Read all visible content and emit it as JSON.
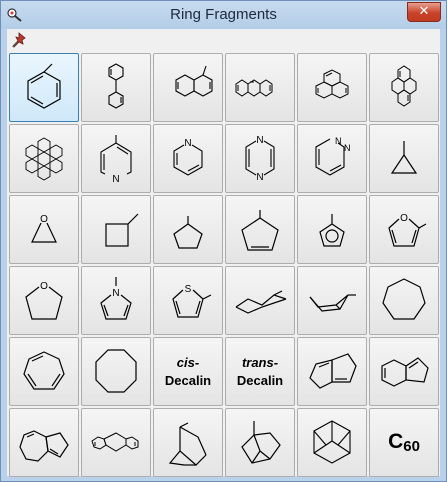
{
  "window": {
    "title": "Ring Fragments",
    "close_label": "✕"
  },
  "toolbar": {
    "pin_icon": "pin-icon"
  },
  "fragments": [
    {
      "id": "methylbenzene",
      "icon": "benzene-icon"
    },
    {
      "id": "biphenyl",
      "icon": "biphenyl-icon"
    },
    {
      "id": "methylnaphthalene",
      "icon": "naphthalene-icon"
    },
    {
      "id": "anthracene",
      "icon": "anthracene-icon"
    },
    {
      "id": "phenanthrene",
      "icon": "phenanthrene-icon"
    },
    {
      "id": "pyrene",
      "icon": "pyrene-icon"
    },
    {
      "id": "coronene",
      "icon": "coronene-icon"
    },
    {
      "id": "pyridine",
      "icon": "pyridine-icon",
      "atom": "N"
    },
    {
      "id": "pyrimidine",
      "icon": "pyrimidine-icon",
      "atom": "N"
    },
    {
      "id": "pyrazine",
      "icon": "pyrazine-icon",
      "atom": "N"
    },
    {
      "id": "pyridazine",
      "icon": "pyridazine-icon",
      "atom": "N"
    },
    {
      "id": "cyclopropane",
      "icon": "cyclopropane-icon"
    },
    {
      "id": "oxirane",
      "icon": "oxirane-icon",
      "atom": "O"
    },
    {
      "id": "cyclobutane",
      "icon": "cyclobutane-icon"
    },
    {
      "id": "cyclopentane",
      "icon": "cyclopentane-icon"
    },
    {
      "id": "cyclopentene",
      "icon": "cyclopentene-icon"
    },
    {
      "id": "cyclopentadienyl",
      "icon": "cyclopentadienyl-icon"
    },
    {
      "id": "methylfuran",
      "icon": "furan-icon",
      "atom": "O"
    },
    {
      "id": "tetrahydrofuran",
      "icon": "tetrahydrofuran-icon",
      "atom": "O"
    },
    {
      "id": "methylpyrrole",
      "icon": "pyrrole-icon",
      "atom": "N"
    },
    {
      "id": "methylthiophene",
      "icon": "thiophene-icon",
      "atom": "S"
    },
    {
      "id": "cyclohexane-chair",
      "icon": "chair-icon"
    },
    {
      "id": "cyclohexane-boat",
      "icon": "boat-icon"
    },
    {
      "id": "cycloheptane",
      "icon": "cycloheptane-icon"
    },
    {
      "id": "cycloheptatriene",
      "icon": "cycloheptatriene-icon"
    },
    {
      "id": "cyclooctane",
      "icon": "cyclooctane-icon"
    },
    {
      "id": "cis-decalin",
      "prefix": "cis-",
      "name": "Decalin"
    },
    {
      "id": "trans-decalin",
      "prefix": "trans-",
      "name": "Decalin"
    },
    {
      "id": "pentalene",
      "icon": "pentalene-icon"
    },
    {
      "id": "indene",
      "icon": "indene-icon"
    },
    {
      "id": "azulene",
      "icon": "azulene-icon"
    },
    {
      "id": "fluorene",
      "icon": "fluorene-icon"
    },
    {
      "id": "norbornane",
      "icon": "norbornane-icon"
    },
    {
      "id": "bicyclooctane",
      "icon": "bicyclooctane-icon"
    },
    {
      "id": "adamantane",
      "icon": "adamantane-icon"
    },
    {
      "id": "fullerene",
      "label": "C",
      "sub": "60"
    }
  ],
  "selected_index": 0
}
